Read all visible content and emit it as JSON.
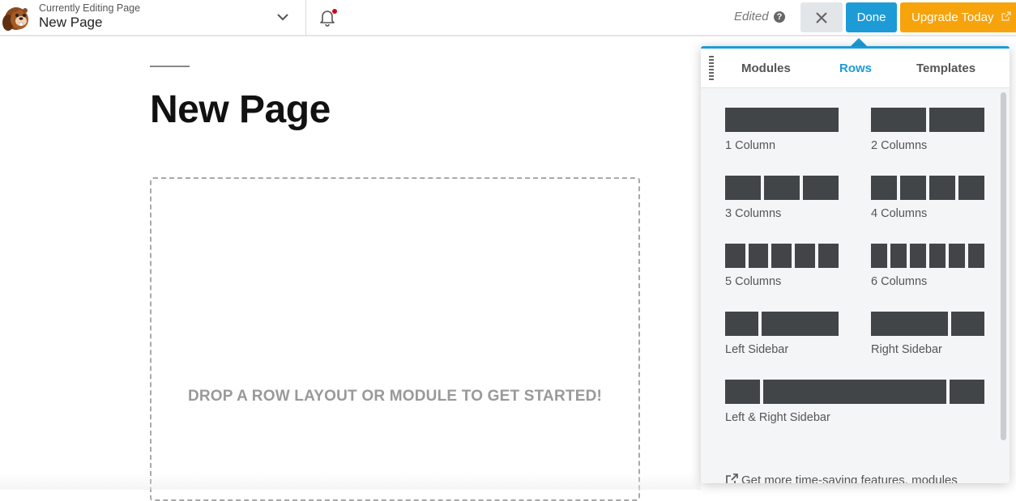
{
  "header": {
    "editing_label": "Currently Editing Page",
    "page_name": "New Page",
    "edited_label": "Edited",
    "help_glyph": "?",
    "done_label": "Done",
    "upgrade_label": "Upgrade Today",
    "notification_dot_color": "#d0021b"
  },
  "content": {
    "page_title": "New Page",
    "drop_message": "DROP A ROW LAYOUT OR MODULE TO GET STARTED!"
  },
  "panel": {
    "tabs": [
      {
        "label": "Modules",
        "active": false
      },
      {
        "label": "Rows",
        "active": true
      },
      {
        "label": "Templates",
        "active": false
      }
    ],
    "rows": [
      {
        "label": "1 Column"
      },
      {
        "label": "2 Columns"
      },
      {
        "label": "3 Columns"
      },
      {
        "label": "4 Columns"
      },
      {
        "label": "5 Columns"
      },
      {
        "label": "6 Columns"
      },
      {
        "label": "Left Sidebar"
      },
      {
        "label": "Right Sidebar"
      },
      {
        "label": "Left & Right Sidebar"
      }
    ],
    "more_link": "Get more time-saving features, modules"
  },
  "colors": {
    "accent": "#1d9bd6",
    "upgrade": "#f7a30c",
    "block": "#424548"
  },
  "icons": {
    "logo": "beaver-logo-icon",
    "chevron": "chevron-down-icon",
    "bell": "bell-icon",
    "help": "help-icon",
    "close": "close-icon",
    "external": "external-link-icon",
    "grip": "drag-handle-icon"
  }
}
